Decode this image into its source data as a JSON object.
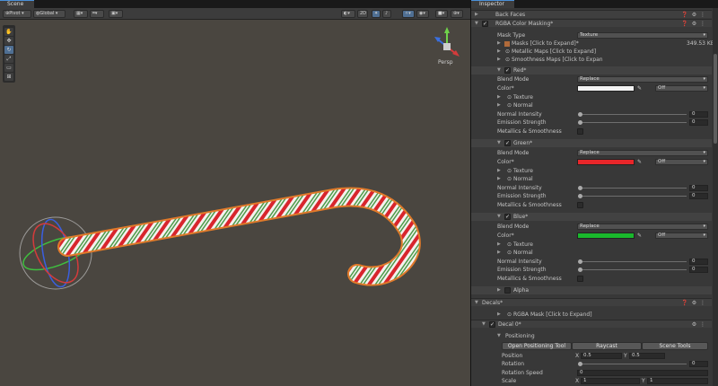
{
  "scene": {
    "tab": "Scene",
    "toolbar": {
      "pivot": "Pivot",
      "global": "Global",
      "mode2d": "2D"
    },
    "persp": "Persp"
  },
  "inspector": {
    "tab": "Inspector",
    "back_faces": "Back Faces",
    "rgba_color_masking": "RGBA Color Masking*",
    "mask_type_label": "Mask Type",
    "mask_type_value": "Texture",
    "masks": "Masks [Click to Expand]*",
    "masks_size": "349.53 KB",
    "metallic_maps": "Metallic Maps [Click to Expand]",
    "smoothness_maps": "Smoothness Maps [Click to Expan",
    "channels": [
      {
        "name": "Red*",
        "blend_mode": "Replace",
        "color": "#f2f2f2",
        "off": "Off",
        "normal_intensity": "0",
        "emission_strength": "0"
      },
      {
        "name": "Green*",
        "blend_mode": "Replace",
        "color": "#e8262a",
        "off": "Off",
        "normal_intensity": "0",
        "emission_strength": "0"
      },
      {
        "name": "Blue*",
        "blend_mode": "Replace",
        "color": "#19b82c",
        "off": "Off",
        "normal_intensity": "0",
        "emission_strength": "0"
      }
    ],
    "labels": {
      "blend_mode": "Blend Mode",
      "color": "Color*",
      "texture": "Texture",
      "normal": "Normal",
      "normal_intensity": "Normal Intensity",
      "emission_strength": "Emission Strength",
      "metallics_smoothness": "Metallics & Smoothness"
    },
    "alpha": "Alpha",
    "decals": "Decals*",
    "rgba_mask": "RGBA Mask [Click to Expand]",
    "decal0": "Decal 0*",
    "positioning": "Positioning",
    "open_positioning_tool": "Open Positioning Tool",
    "raycast": "Raycast",
    "scene_tools": "Scene Tools",
    "position_label": "Position",
    "position_x": "0.5",
    "position_y": "0.5",
    "rotation_label": "Rotation",
    "rotation_value": "0",
    "rotation_speed_label": "Rotation Speed",
    "rotation_speed_value": "0",
    "scale_label": "Scale",
    "scale_x": "1",
    "scale_y": "1",
    "x": "X",
    "y": "Y"
  }
}
